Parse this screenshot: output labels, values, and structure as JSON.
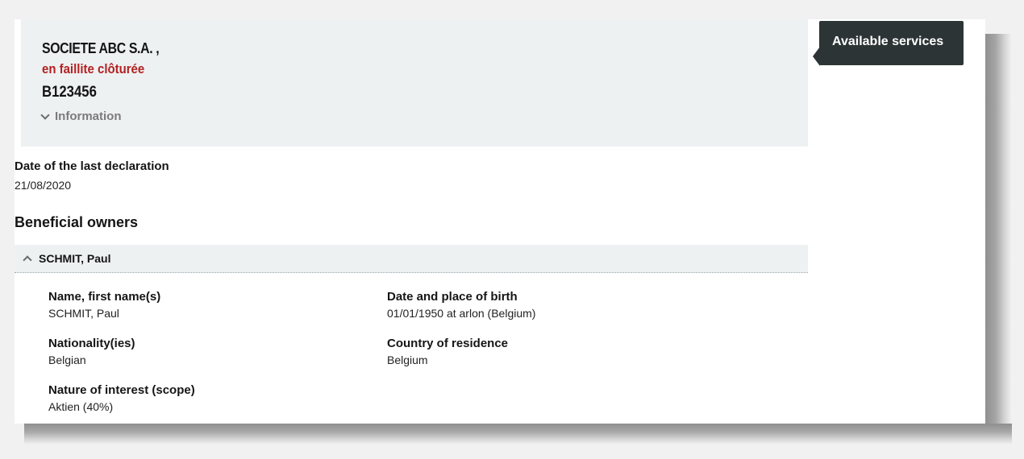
{
  "company": {
    "name": "SOCIETE ABC S.A. ,",
    "status": "en faillite clôturée",
    "id": "B123456",
    "info_toggle": "Information"
  },
  "last_declaration": {
    "label": "Date of the last declaration",
    "value": "21/08/2020"
  },
  "beneficial_owners": {
    "title": "Beneficial owners",
    "owner": {
      "header": "SCHMIT, Paul",
      "name_label": "Name, first name(s)",
      "name_value": "SCHMIT, Paul",
      "birth_label": "Date and place of birth",
      "birth_value": "01/01/1950 at arlon (Belgium)",
      "nationality_label": "Nationality(ies)",
      "nationality_value": "Belgian",
      "residence_label": "Country of residence",
      "residence_value": "Belgium",
      "scope_label": "Nature of interest (scope)",
      "scope_value": "Aktien (40%)"
    }
  },
  "services": {
    "label": "Available services"
  },
  "icons": {
    "info_toggle": "chevron-down-icon",
    "owner_toggle": "chevron-up-icon"
  },
  "colors": {
    "status_red": "#b22222",
    "panel_bg": "#eef1f2",
    "services_bg": "#2d3436"
  }
}
